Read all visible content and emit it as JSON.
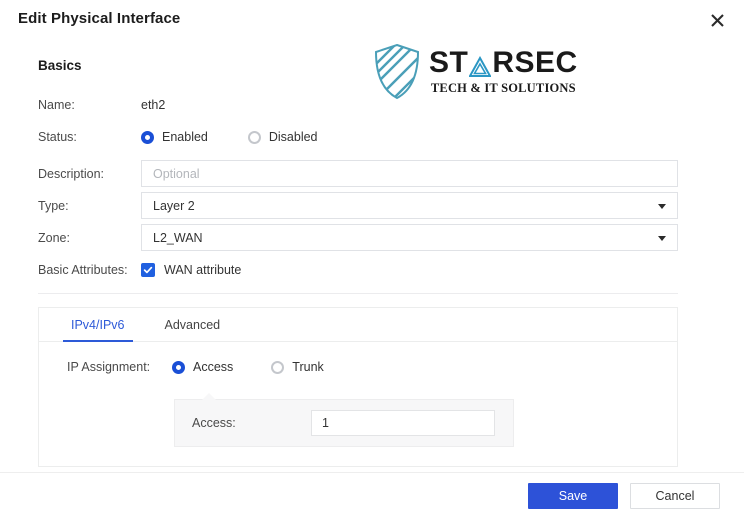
{
  "dialog": {
    "title": "Edit Physical Interface",
    "close_icon": "close-icon"
  },
  "brand": {
    "shield_icon": "shield-icon",
    "name_part1": "ST",
    "name_triangle": "triangle-a-glyph",
    "name_part2": "RSEC",
    "tagline": "TECH & IT SOLUTIONS",
    "accent_color": "#4a9fb8"
  },
  "basics": {
    "heading": "Basics",
    "name": {
      "label": "Name:",
      "value": "eth2"
    },
    "status": {
      "label": "Status:",
      "options": [
        {
          "label": "Enabled",
          "selected": true
        },
        {
          "label": "Disabled",
          "selected": false
        }
      ]
    },
    "description": {
      "label": "Description:",
      "value": "",
      "placeholder": "Optional"
    },
    "type": {
      "label": "Type:",
      "value": "Layer 2",
      "caret_icon": "chevron-down-icon"
    },
    "zone": {
      "label": "Zone:",
      "value": "L2_WAN",
      "caret_icon": "chevron-down-icon"
    },
    "attributes": {
      "label": "Basic Attributes:",
      "checkbox_label": "WAN attribute",
      "checked": true,
      "check_icon": "check-icon"
    }
  },
  "tabs": [
    {
      "label": "IPv4/IPv6",
      "active": true
    },
    {
      "label": "Advanced",
      "active": false
    }
  ],
  "ip_assignment": {
    "label": "IP Assignment:",
    "options": [
      {
        "label": "Access",
        "selected": true
      },
      {
        "label": "Trunk",
        "selected": false
      }
    ]
  },
  "access_panel": {
    "label": "Access:",
    "value": "1"
  },
  "footer": {
    "save_label": "Save",
    "cancel_label": "Cancel",
    "primary_color": "#2d52d8"
  }
}
